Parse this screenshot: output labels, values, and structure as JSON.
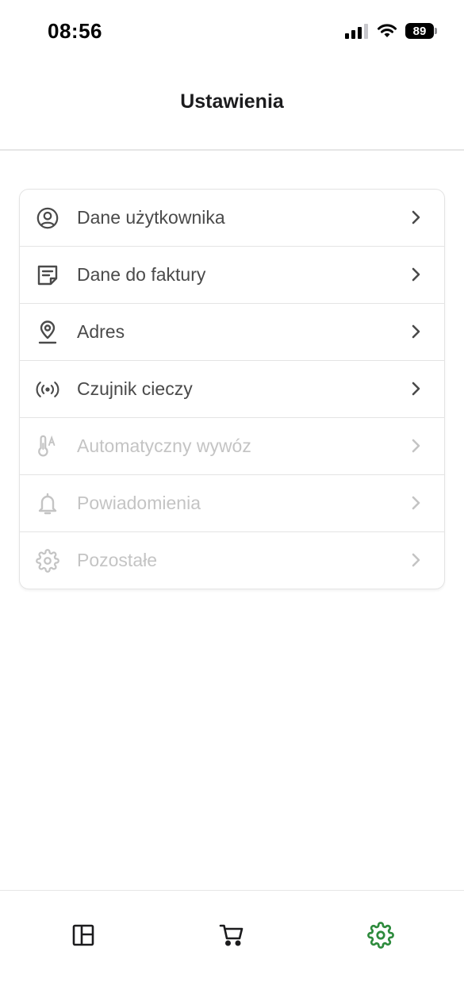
{
  "status_bar": {
    "time": "08:56",
    "battery": "89"
  },
  "header": {
    "title": "Ustawienia"
  },
  "menu": [
    {
      "label": "Dane użytkownika",
      "icon": "account-circle-icon",
      "enabled": true
    },
    {
      "label": "Dane do faktury",
      "icon": "sticky-note-icon",
      "enabled": true
    },
    {
      "label": "Adres",
      "icon": "location-pin-icon",
      "enabled": true
    },
    {
      "label": "Czujnik cieczy",
      "icon": "sensor-broadcast-icon",
      "enabled": true
    },
    {
      "label": "Automatyczny wywóz",
      "icon": "thermometer-auto-icon",
      "enabled": false
    },
    {
      "label": "Powiadomienia",
      "icon": "bell-icon",
      "enabled": false
    },
    {
      "label": "Pozostałe",
      "icon": "gear-icon",
      "enabled": false
    }
  ],
  "tab_bar": {
    "tabs": [
      {
        "icon": "dashboard-icon",
        "active": false
      },
      {
        "icon": "cart-icon",
        "active": false
      },
      {
        "icon": "settings-gear-icon",
        "active": true
      }
    ]
  },
  "colors": {
    "accent": "#2e8b3d",
    "text": "#4a4a4a",
    "disabled": "#c4c4c4",
    "divider": "#e4e4e4"
  }
}
